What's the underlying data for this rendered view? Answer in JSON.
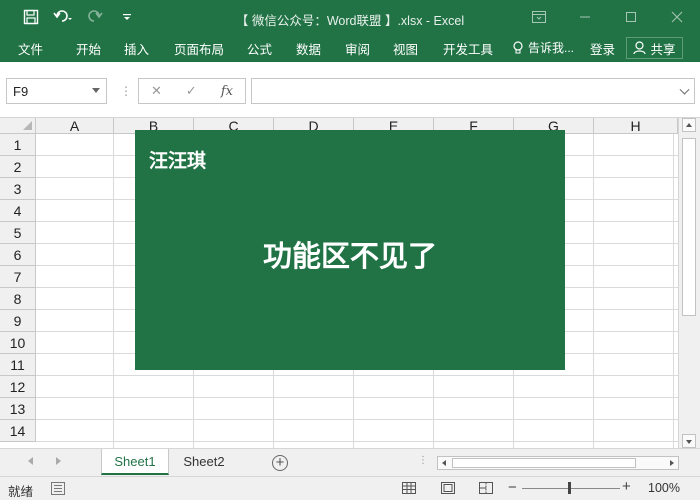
{
  "window": {
    "title": "【 微信公众号：Word联盟 】.xlsx - Excel"
  },
  "ribbon": {
    "tabs": [
      "文件",
      "开始",
      "插入",
      "页面布局",
      "公式",
      "数据",
      "审阅",
      "视图",
      "开发工具"
    ],
    "tell_me": "告诉我...",
    "login": "登录",
    "share": "共享"
  },
  "formula_bar": {
    "name_box": "F9",
    "fx_label": "fx",
    "formula_value": ""
  },
  "grid": {
    "columns": [
      "A",
      "B",
      "C",
      "D",
      "E",
      "F",
      "G",
      "H"
    ],
    "rows": [
      "1",
      "2",
      "3",
      "4",
      "5",
      "6",
      "7",
      "8",
      "9",
      "10",
      "11",
      "12",
      "13",
      "14"
    ]
  },
  "overlay": {
    "brand": "汪汪琪",
    "headline": "功能区不见了",
    "background": "#217346"
  },
  "sheets": {
    "tabs": [
      "Sheet1",
      "Sheet2"
    ],
    "active": "Sheet1",
    "add_label": "+"
  },
  "statusbar": {
    "status": "就绪",
    "zoom": "100%"
  },
  "theme": {
    "accent": "#217346"
  }
}
